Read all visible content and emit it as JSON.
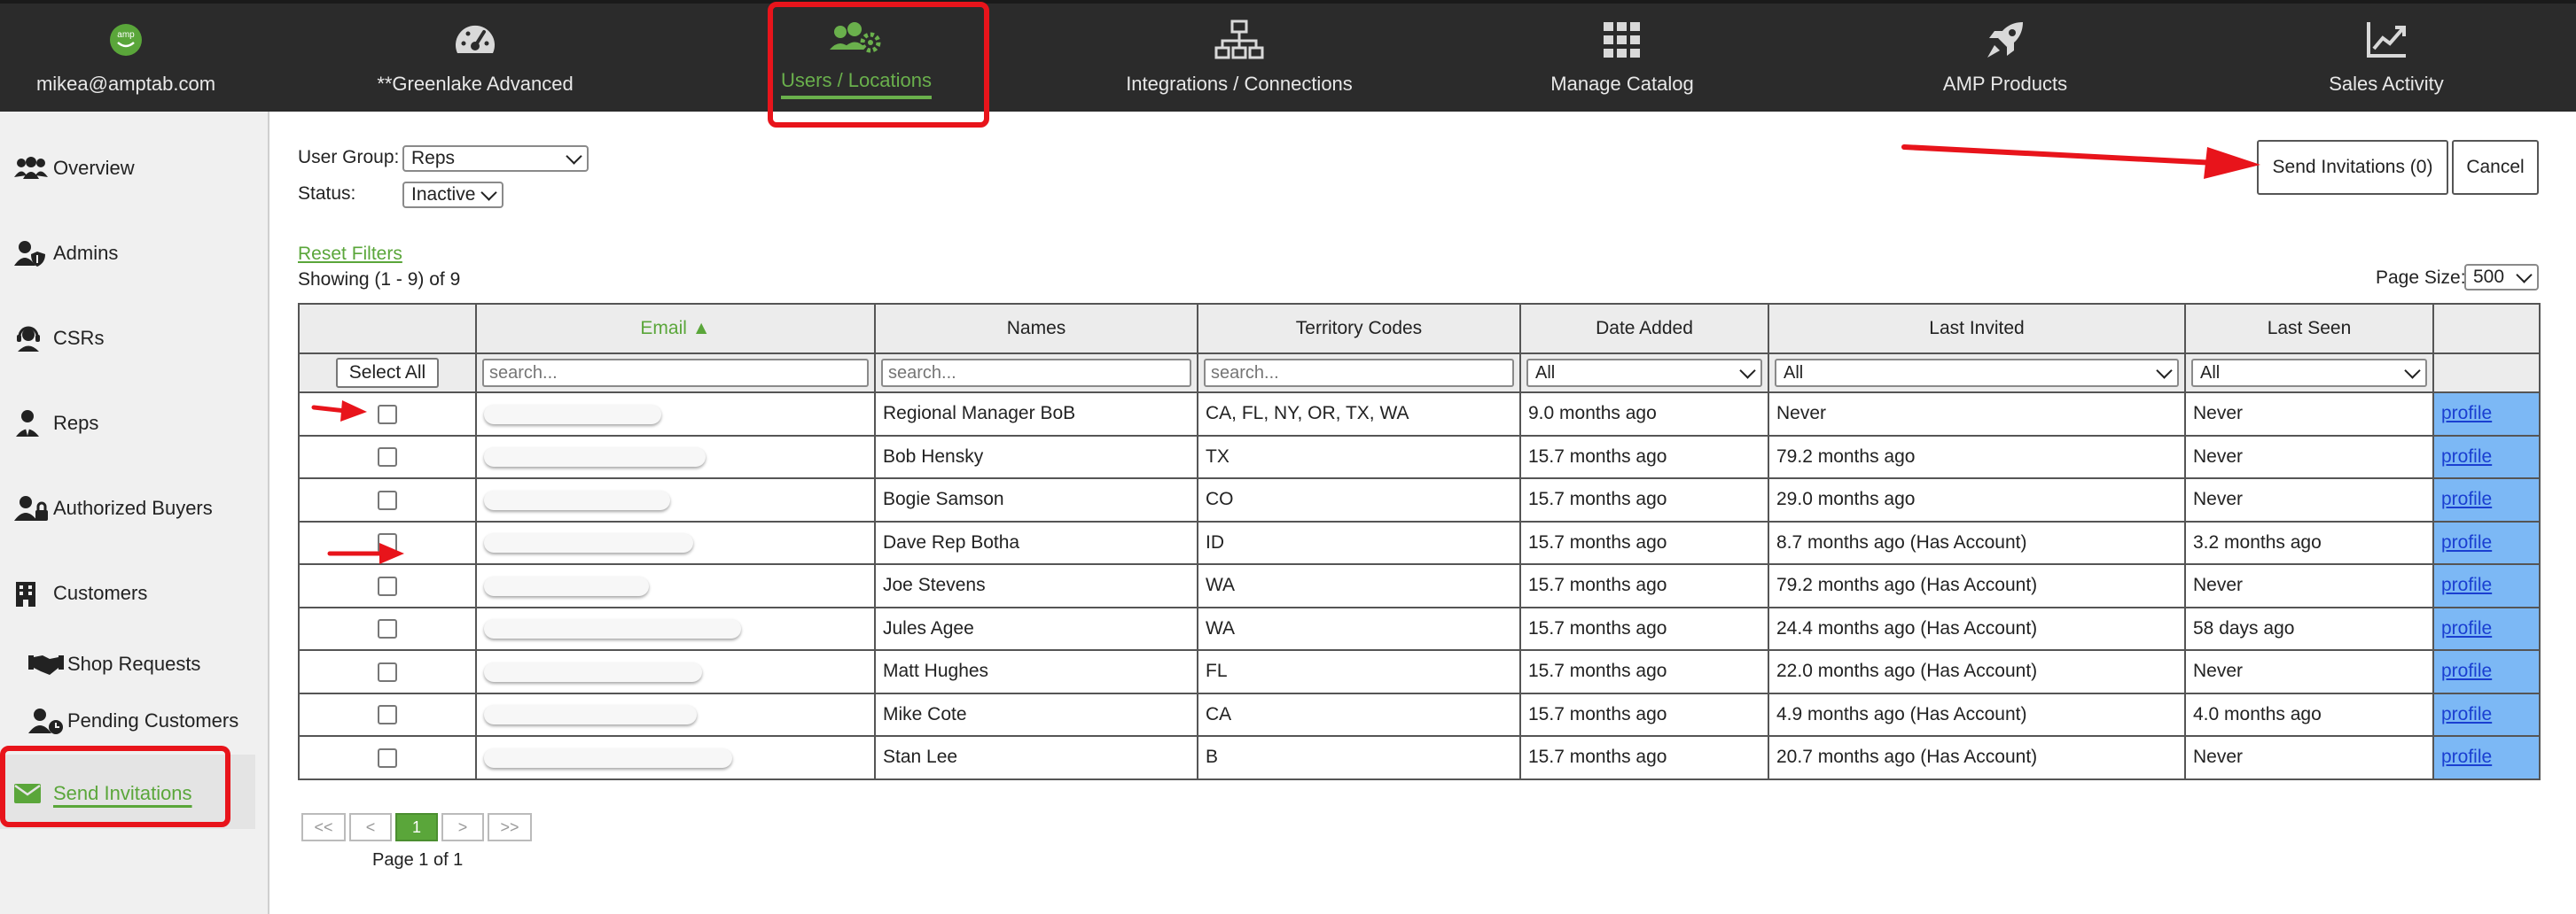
{
  "topnav": {
    "user_email": "mikea@amptab.com",
    "items": [
      {
        "label": "**Greenlake Advanced",
        "icon": "gauge-icon"
      },
      {
        "label": "Users / Locations",
        "icon": "users-gear-icon"
      },
      {
        "label": "Integrations / Connections",
        "icon": "network-icon"
      },
      {
        "label": "Manage Catalog",
        "icon": "grid-icon"
      },
      {
        "label": "AMP Products",
        "icon": "rocket-icon"
      },
      {
        "label": "Sales Activity",
        "icon": "chart-line-icon"
      }
    ],
    "active_color": "#6ab04c"
  },
  "sidebar": {
    "items": [
      {
        "label": "Overview",
        "icon": "users-icon"
      },
      {
        "label": "Admins",
        "icon": "user-shield-icon"
      },
      {
        "label": "CSRs",
        "icon": "headset-icon"
      },
      {
        "label": "Reps",
        "icon": "user-tie-icon"
      },
      {
        "label": "Authorized Buyers",
        "icon": "user-lock-icon"
      },
      {
        "label": "Customers",
        "icon": "building-icon"
      },
      {
        "label": "Shop Requests",
        "icon": "handshake-icon"
      },
      {
        "label": "Pending Customers",
        "icon": "user-clock-icon"
      },
      {
        "label": "Send Invitations",
        "icon": "envelope-icon"
      }
    ]
  },
  "filters": {
    "user_group_label": "User Group:",
    "user_group_value": "Reps",
    "status_label": "Status:",
    "status_value": "Inactive",
    "reset_label": "Reset Filters",
    "showing": "Showing (1 - 9) of 9",
    "page_size_label": "Page Size:",
    "page_size_value": "500"
  },
  "actions": {
    "send_label": "Send Invitations (0)",
    "cancel_label": "Cancel"
  },
  "table": {
    "select_all_label": "Select All",
    "headers": {
      "email": "Email ▲",
      "names": "Names",
      "territory": "Territory Codes",
      "date_added": "Date Added",
      "last_invited": "Last Invited",
      "last_seen": "Last Seen"
    },
    "search_placeholder": "search...",
    "all_option": "All",
    "profile_label": "profile",
    "rows": [
      {
        "name": "Regional Manager BoB",
        "territory": "CA, FL, NY, OR, TX, WA",
        "date_added": "9.0 months ago",
        "last_invited": "Never",
        "last_seen": "Never"
      },
      {
        "name": "Bob Hensky",
        "territory": "TX",
        "date_added": "15.7 months ago",
        "last_invited": "79.2 months ago",
        "last_seen": "Never"
      },
      {
        "name": "Bogie Samson",
        "territory": "CO",
        "date_added": "15.7 months ago",
        "last_invited": "29.0 months ago",
        "last_seen": "Never"
      },
      {
        "name": "Dave Rep Botha",
        "territory": "ID",
        "date_added": "15.7 months ago",
        "last_invited": "8.7 months ago (Has Account)",
        "last_seen": "3.2 months ago"
      },
      {
        "name": "Joe Stevens",
        "territory": "WA",
        "date_added": "15.7 months ago",
        "last_invited": "79.2 months ago (Has Account)",
        "last_seen": "Never"
      },
      {
        "name": "Jules Agee",
        "territory": "WA",
        "date_added": "15.7 months ago",
        "last_invited": "24.4 months ago (Has Account)",
        "last_seen": "58 days ago"
      },
      {
        "name": "Matt Hughes",
        "territory": "FL",
        "date_added": "15.7 months ago",
        "last_invited": "22.0 months ago (Has Account)",
        "last_seen": "Never"
      },
      {
        "name": "Mike Cote",
        "territory": "CA",
        "date_added": "15.7 months ago",
        "last_invited": "4.9 months ago (Has Account)",
        "last_seen": "4.0 months ago"
      },
      {
        "name": "Stan Lee",
        "territory": "B",
        "date_added": "15.7 months ago",
        "last_invited": "20.7 months ago (Has Account)",
        "last_seen": "Never"
      }
    ]
  },
  "pagination": {
    "first": "<<",
    "prev": "<",
    "current": "1",
    "next": ">",
    "last": ">>",
    "page_text": "Page 1 of 1"
  },
  "colors": {
    "accent_green": "#5aa63a",
    "highlight_red": "#e8141b",
    "profile_cell": "#7cb8f5"
  }
}
